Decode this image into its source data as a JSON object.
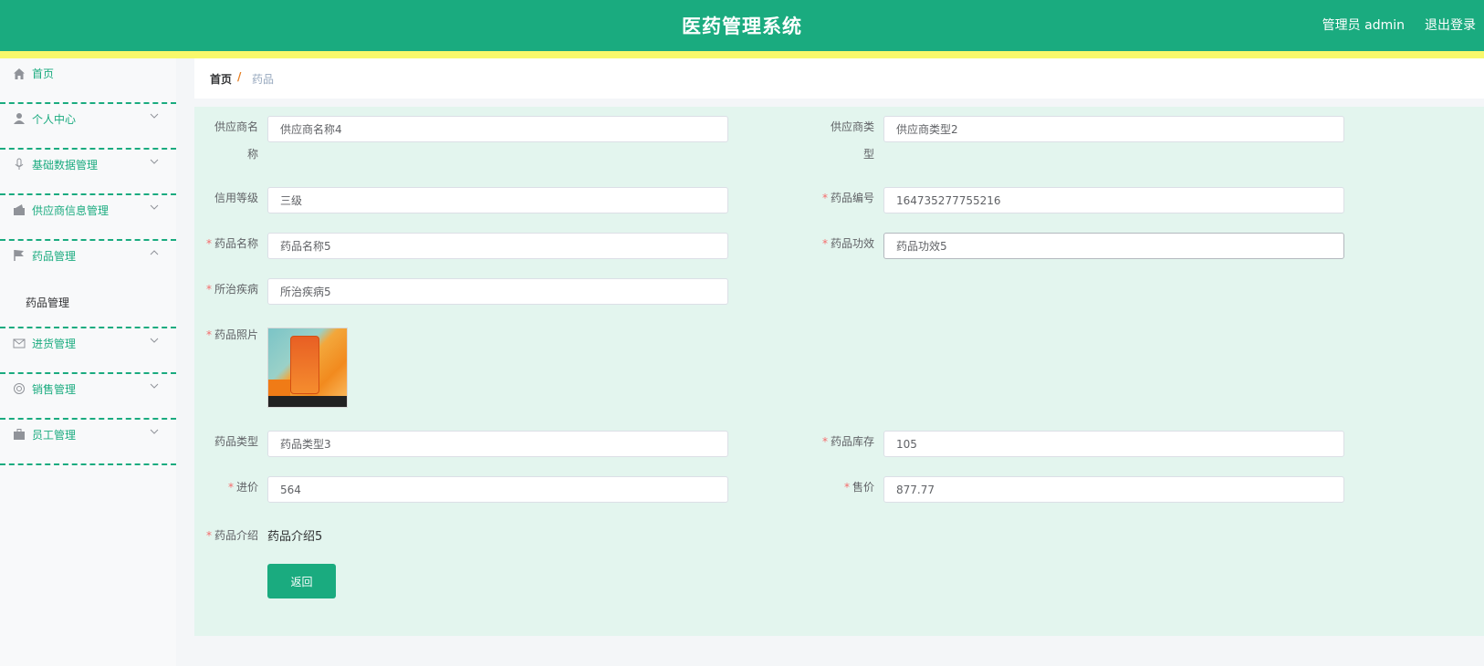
{
  "header": {
    "title": "医药管理系统",
    "user": "管理员 admin",
    "logout": "退出登录"
  },
  "sidebar": {
    "items": [
      {
        "label": "首页",
        "icon": "home-icon"
      },
      {
        "label": "个人中心",
        "icon": "user-icon"
      },
      {
        "label": "基础数据管理",
        "icon": "microphone-icon"
      },
      {
        "label": "供应商信息管理",
        "icon": "wallet-icon"
      },
      {
        "label": "药品管理",
        "icon": "flag-icon",
        "expanded": true
      },
      {
        "label": "进货管理",
        "icon": "mail-icon"
      },
      {
        "label": "销售管理",
        "icon": "lifebuoy-icon"
      },
      {
        "label": "员工管理",
        "icon": "briefcase-icon"
      }
    ],
    "submenu": {
      "label": "药品管理"
    }
  },
  "breadcrumb": {
    "home": "首页",
    "separator": "/",
    "current": "药品"
  },
  "form": {
    "supplier_name": {
      "label1": "供应商名",
      "label2": "称",
      "value": "供应商名称4"
    },
    "supplier_type": {
      "label1": "供应商类",
      "label2": "型",
      "value": "供应商类型2"
    },
    "credit_level": {
      "label": "信用等级",
      "value": "三级"
    },
    "drug_code": {
      "label": "药品编号",
      "value": "164735277755216"
    },
    "drug_name": {
      "label": "药品名称",
      "value": "药品名称5"
    },
    "drug_effect": {
      "label": "药品功效",
      "value": "药品功效5"
    },
    "disease": {
      "label": "所治疾病",
      "value": "所治疾病5"
    },
    "photo": {
      "label": "药品照片"
    },
    "drug_type": {
      "label": "药品类型",
      "value": "药品类型3"
    },
    "stock": {
      "label": "药品库存",
      "value": "105"
    },
    "purchase_price": {
      "label": "进价",
      "value": "564"
    },
    "sale_price": {
      "label": "售价",
      "value": "877.77"
    },
    "intro": {
      "label": "药品介绍",
      "value": "药品介绍5"
    },
    "back_button": "返回"
  },
  "colors": {
    "primary": "#1aab7f",
    "header_stripe": "#f8f86b",
    "panel_bg": "#e3f5ee",
    "required": "#f56c6c",
    "breadcrumb_sep": "#e67e22"
  }
}
